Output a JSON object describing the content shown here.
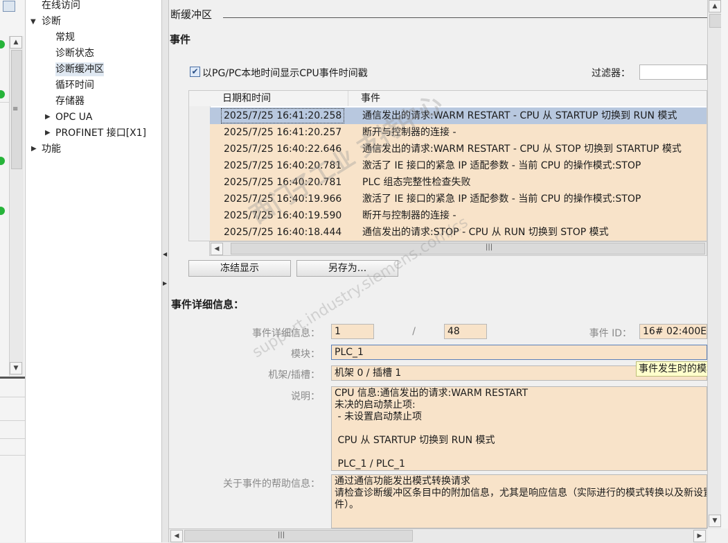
{
  "nav": {
    "items": [
      {
        "label": "在线访问"
      },
      {
        "label": "诊断"
      },
      {
        "label": "常规"
      },
      {
        "label": "诊断状态"
      },
      {
        "label": "诊断缓冲区"
      },
      {
        "label": "循环时间"
      },
      {
        "label": "存储器"
      },
      {
        "label": "OPC UA"
      },
      {
        "label": "PROFINET 接口[X1]"
      },
      {
        "label": "功能"
      }
    ]
  },
  "header": {
    "section": "断缓冲区"
  },
  "events": {
    "title": "事件",
    "checkbox_label": "以PG/PC本地时间显示CPU事件时间戳",
    "checkbox_checked": true,
    "filter_label": "过滤器：",
    "filter_value": "",
    "columns": [
      "日期和时间",
      "事件"
    ],
    "rows": [
      {
        "time": "2025/7/25 16:41:20.258",
        "event": "通信发出的请求:WARM RESTART  - CPU 从 STARTUP 切换到 RUN 模式"
      },
      {
        "time": "2025/7/25 16:41:20.257",
        "event": "断开与控制器的连接 -"
      },
      {
        "time": "2025/7/25 16:40:22.646",
        "event": "通信发出的请求:WARM RESTART  - CPU 从 STOP 切换到 STARTUP 模式"
      },
      {
        "time": "2025/7/25 16:40:20.781",
        "event": "激活了 IE 接口的紧急 IP 适配参数 - 当前 CPU 的操作模式:STOP"
      },
      {
        "time": "2025/7/25 16:40:20.781",
        "event": "PLC 组态完整性检查失败"
      },
      {
        "time": "2025/7/25 16:40:19.966",
        "event": "激活了 IE 接口的紧急 IP 适配参数 - 当前 CPU 的操作模式:STOP"
      },
      {
        "time": "2025/7/25 16:40:19.590",
        "event": "断开与控制器的连接 -"
      },
      {
        "time": "2025/7/25 16:40:18.444",
        "event": "通信发出的请求:STOP  - CPU 从 RUN 切换到 STOP 模式"
      }
    ],
    "freeze_button": "冻结显示",
    "save_as_button": "另存为..."
  },
  "details": {
    "title": "事件详细信息：",
    "detail_label": "事件详细信息：",
    "detail_index": "1",
    "detail_sep": "/",
    "detail_total": "48",
    "event_id_label": "事件 ID：",
    "event_id": "16# 02:400E",
    "module_label": "模块：",
    "module_value": "PLC_1",
    "rack_label": "机架/插槽：",
    "rack_value": "机架 0 / 插槽 1",
    "desc_label": "说明：",
    "desc_value": "CPU 信息:通信发出的请求:WARM RESTART\n未决的启动禁止项:\n - 未设置启动禁止项\n\n CPU 从 STARTUP 切换到 RUN 模式\n\n PLC_1 / PLC_1",
    "help_label": "关于事件的帮助信息：",
    "help_value": "通过通信功能发出模式转换请求\n请检查诊断缓冲区条目中的附加信息，尤其是响应信息（实际进行的模式转换以及新设置\n件）。"
  },
  "tooltip": "事件发生时的模块和设",
  "watermark": {
    "line1": "西门子工业 支持中心",
    "line2": "support.industry.siemens.com/cs"
  },
  "colors": {
    "row_bg": "#f8e3c9",
    "row_selected": "#b8c8df",
    "status_green": "#27b43a"
  }
}
